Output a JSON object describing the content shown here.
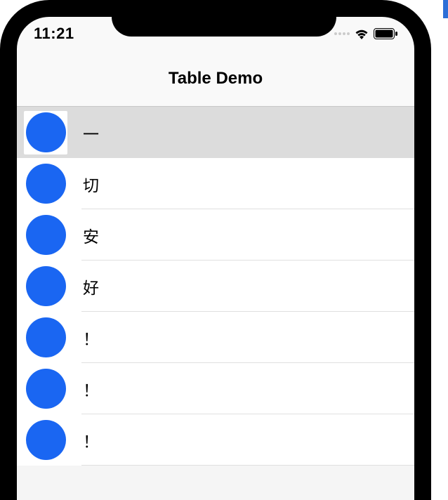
{
  "status": {
    "time": "11:21",
    "wifi_icon": "wifi",
    "battery_icon": "battery-full"
  },
  "nav": {
    "title": "Table Demo"
  },
  "table": {
    "rows": [
      {
        "label": "一",
        "highlighted": true,
        "icon_color": "#1a66f2"
      },
      {
        "label": "切",
        "highlighted": false,
        "icon_color": "#1a66f2"
      },
      {
        "label": "安",
        "highlighted": false,
        "icon_color": "#1a66f2"
      },
      {
        "label": "好",
        "highlighted": false,
        "icon_color": "#1a66f2"
      },
      {
        "label": "！",
        "highlighted": false,
        "icon_color": "#1a66f2"
      },
      {
        "label": "！",
        "highlighted": false,
        "icon_color": "#1a66f2"
      },
      {
        "label": "！",
        "highlighted": false,
        "icon_color": "#1a66f2"
      }
    ]
  }
}
